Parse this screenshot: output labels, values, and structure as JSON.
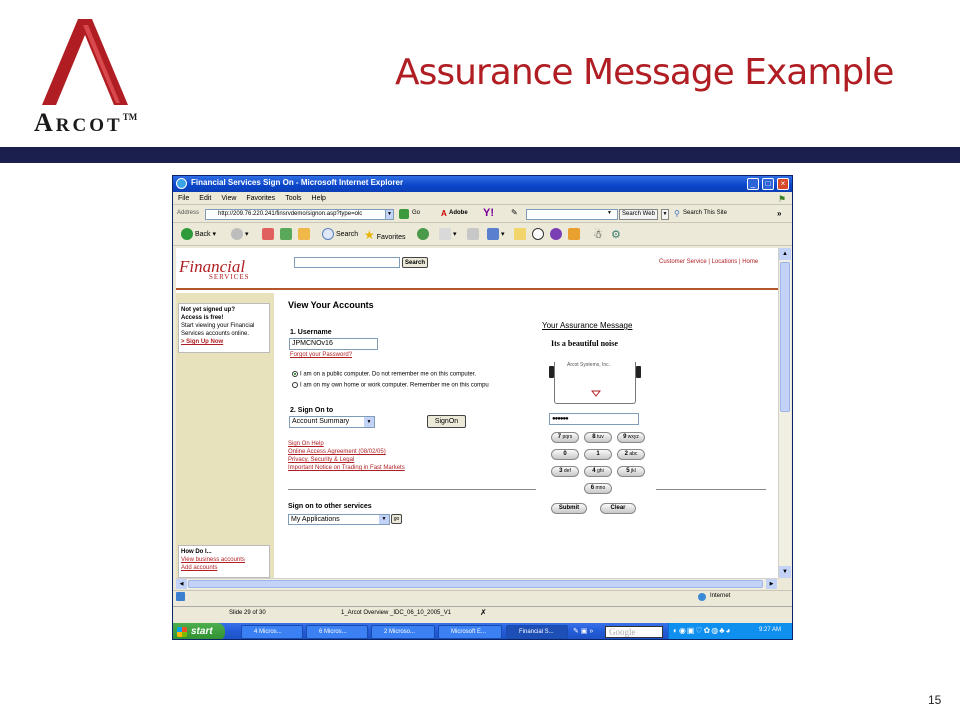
{
  "slide": {
    "title": "Assurance Message Example",
    "logo_text_first": "A",
    "logo_text_rest": "RCOT",
    "logo_tm": "TM",
    "page_number": "15",
    "colors": {
      "title": "#b01e23",
      "bar": "#1b1f4d",
      "logo_red": "#b01e23"
    }
  },
  "window": {
    "title": "Financial Services Sign On - Microsoft Internet Explorer",
    "menu": [
      "File",
      "Edit",
      "View",
      "Favorites",
      "Tools",
      "Help"
    ],
    "address_label": "Address",
    "address_value": "http://209.76.220.241/finsrvdemo/signon.asp?type=olc",
    "go_label": "Go",
    "adobe_label": "Adobe",
    "search_web_label": "Search Web",
    "search_site_label": "Search This Site",
    "back_label": "Back",
    "search_label": "Search",
    "favorites_label": "Favorites",
    "chevron": "»",
    "status_zone": "Internet"
  },
  "page": {
    "brand_top": "Financial",
    "brand_bottom": "SERVICES",
    "search_button": "Search",
    "top_links": {
      "service": "Customer Service",
      "sep1": "|",
      "locations": "Locations",
      "sep2": "|",
      "home": "Home"
    },
    "sidebar": {
      "promo_line1": "Not yet signed up?",
      "promo_line2": "Access is free!",
      "promo_line3": "Start viewing your Financial",
      "promo_line4": "Services accounts online.",
      "signup_link": "> Sign Up Now",
      "howdo_title": "How Do I...",
      "howdo_link1": "View business accounts",
      "howdo_link2": "Add accounts"
    },
    "heading": "View Your Accounts",
    "username_label": "1. Username",
    "username_value": "JPMCNOv16",
    "forgot_link": "Forgot your Password?",
    "radio_public": "I am on a public computer. Do not remember me on this computer.",
    "radio_private": "I am on my own home or work computer. Remember me on this compu",
    "signon_to_label": "2. Sign On to",
    "signon_select": "Account Summary",
    "signon_button": "SignOn",
    "help_links": [
      "Sign On Help",
      "Online Access Agreement (08/02/05)",
      "Privacy, Security & Legal",
      "Important Notice on Trading in Fast Markets"
    ],
    "other_services_label": "Sign on to other services",
    "other_services_select": "My Applications",
    "go_button": "go"
  },
  "assurance": {
    "title": "Your Assurance Message",
    "message": "Its a beautiful noise",
    "card_text": "Arcot Systems, Inc.",
    "password_mask": "●●●●●●",
    "keypad": [
      {
        "num": "7",
        "sub": "pqrs"
      },
      {
        "num": "8",
        "sub": "tuv"
      },
      {
        "num": "9",
        "sub": "wxyz"
      },
      {
        "num": "0",
        "sub": ""
      },
      {
        "num": "1",
        "sub": ""
      },
      {
        "num": "2",
        "sub": "abc"
      },
      {
        "num": "3",
        "sub": "def"
      },
      {
        "num": "4",
        "sub": "ghi"
      },
      {
        "num": "5",
        "sub": "jkl"
      },
      {
        "num": "6",
        "sub": "mno"
      }
    ],
    "submit": "Submit",
    "clear": "Clear"
  },
  "ppt_status": {
    "slide": "Slide 29 of 30",
    "file": "1_Arcot Overview _IDC_06_10_2005_V1"
  },
  "taskbar": {
    "start": "start",
    "items": [
      "4 Micros...",
      "6 Micros...",
      "2 Microso...",
      "Microsoft E...",
      "Financial S..."
    ],
    "google": "Google",
    "clock": "9:27 AM"
  }
}
